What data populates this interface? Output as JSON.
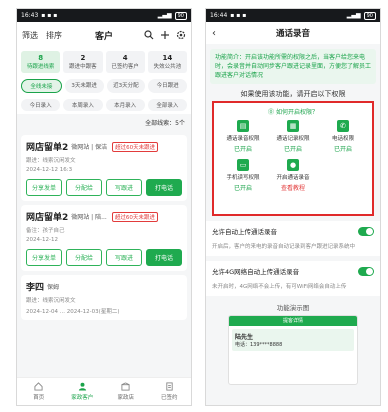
{
  "left": {
    "status": {
      "time": "16:43",
      "battery": "90"
    },
    "header": {
      "filter": "筛选",
      "sort": "排序",
      "title": "客户"
    },
    "stats": [
      {
        "num": "8",
        "label": "待跟进线索",
        "active": true
      },
      {
        "num": "2",
        "label": "跟进中跟客"
      },
      {
        "num": "4",
        "label": "已签约客户"
      },
      {
        "num": "14",
        "label": "失效公共池"
      }
    ],
    "chips_row1": [
      "全线未接",
      "3天未跟进",
      "近3天分配",
      "今日跟进"
    ],
    "chips_row2": [
      "今日录入",
      "本周录入",
      "本月录入",
      "全部录入"
    ],
    "total_label": "全部线索：5个",
    "cards": [
      {
        "name": "网店留单2",
        "meta": "微网站 | 保洁",
        "tag": "超过60天未跟进",
        "line1": "跟进：线索沉闲发文",
        "line2": "2024-12-12 16:3",
        "buttons": [
          "分享发单",
          "分配给",
          "写跟进",
          "打电话"
        ]
      },
      {
        "name": "网店留单2",
        "meta": "微网站 | 陪...",
        "tag": "超过60天未跟进",
        "line1": "备注：孩子自己",
        "line2": "2024-12-12",
        "buttons": [
          "分享发单",
          "分配给",
          "写跟进",
          "打电话"
        ]
      },
      {
        "name": "李四",
        "meta": "保姆",
        "tag": "",
        "line1": "跟进：线索沉闲发文",
        "line2": "2024-12-04 ... 2024-12-03(星期二)",
        "buttons": []
      }
    ],
    "nav": [
      "首页",
      "家政客户",
      "家政店",
      "已签约"
    ]
  },
  "right": {
    "status": {
      "time": "16:44",
      "battery": "90"
    },
    "header": {
      "back": "‹",
      "title": "通话录音"
    },
    "desc": "功能简介：开启该功能所需的权限之后，当客户给您来电时，会录音并自动同步客户跟进记录里面，方便您了解员工跟进客户对话情况",
    "section_title": "如果使用该功能，请开启以下权限",
    "perm_link": "⓪ 如何开启权限？",
    "perms": [
      {
        "label": "通话录音权限",
        "status": "已开启"
      },
      {
        "label": "通话记录权限",
        "status": "已开启"
      },
      {
        "label": "电话权限",
        "status": "已开启"
      },
      {
        "label": "手机读写权限",
        "status": "已开启"
      },
      {
        "label": "开启通话录音",
        "status": "查看教程",
        "warn": true
      }
    ],
    "settings": [
      {
        "label": "允许自动上传通话录音",
        "note": "开启后，客户的来电的录音自动记录到客户跟进记录系统中"
      },
      {
        "label": "允许4G网络自动上传通话录音",
        "note": "未开启时，4G网络不会上传，有可WiFi网络会自动上传"
      }
    ],
    "demo_title": "功能演示图",
    "demo": {
      "head": "提客详情",
      "name": "陆先生",
      "sub": "电话：139****8888"
    }
  },
  "colors": {
    "accent": "#1faa4f",
    "warn": "#e23b3b"
  }
}
